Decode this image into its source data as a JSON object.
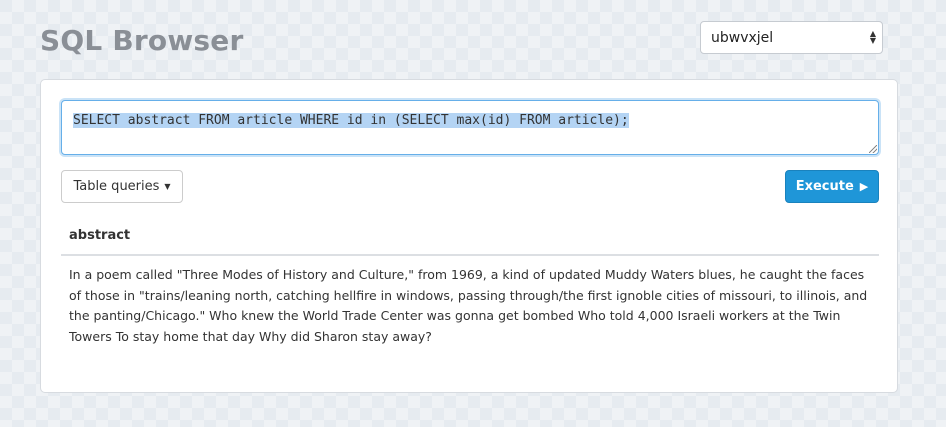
{
  "app": {
    "title": "SQL Browser"
  },
  "database_select": {
    "selected": "ubwvxjel"
  },
  "query": {
    "text": "SELECT abstract FROM article WHERE id in (SELECT max(id) FROM article);"
  },
  "toolbar": {
    "table_queries_label": "Table queries",
    "execute_label": "Execute"
  },
  "results": {
    "columns": [
      "abstract"
    ],
    "rows": [
      [
        "In a poem called \"Three Modes of History and Culture,\" from 1969, a kind of updated Muddy Waters blues, he caught the faces of those in \"trains/leaning north, catching hellfire in windows, passing through/the first ignoble cities of missouri, to illinois, and the panting/Chicago.\" Who knew the World Trade Center was gonna get bombed Who told 4,000 Israeli workers at the Twin Towers To stay home that day Why did Sharon stay away?"
      ]
    ]
  },
  "colors": {
    "accent": "#1f96d8",
    "title": "#8a8f96",
    "selection": "#b4d4f4"
  },
  "icons": {
    "dropdown": "caret-down-icon",
    "execute": "play-icon",
    "select": "up-down-caret-icon"
  }
}
